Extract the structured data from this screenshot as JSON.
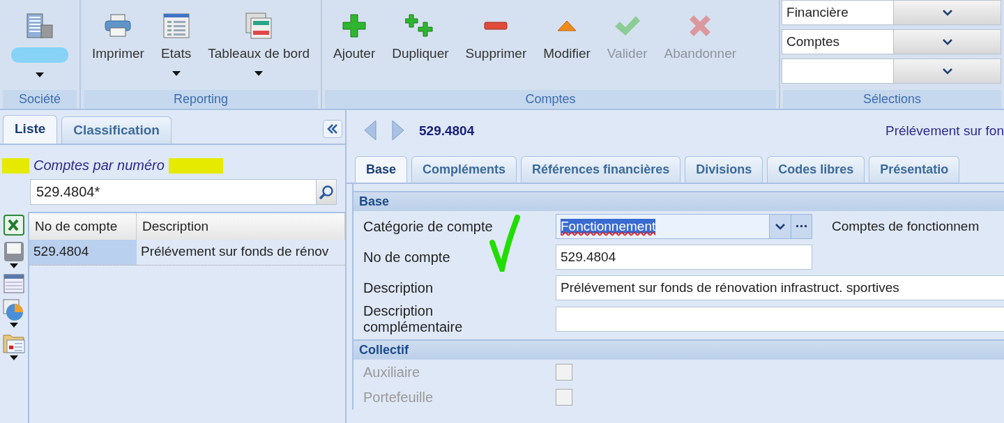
{
  "ribbon": {
    "groups": [
      {
        "label": "Société",
        "buttons": [
          {
            "kind": "company",
            "redacted": true,
            "dropdown": true
          }
        ]
      },
      {
        "label": "Reporting",
        "buttons": [
          {
            "kind": "print",
            "label": "Imprimer",
            "dropdown": false,
            "disabled": false
          },
          {
            "kind": "states",
            "label": "Etats",
            "dropdown": true,
            "disabled": false
          },
          {
            "kind": "dashboard",
            "label": "Tableaux de bord",
            "dropdown": true,
            "disabled": false
          }
        ]
      },
      {
        "label": "Comptes",
        "buttons": [
          {
            "kind": "add",
            "label": "Ajouter",
            "dropdown": false,
            "disabled": false
          },
          {
            "kind": "duplicate",
            "label": "Dupliquer",
            "dropdown": false,
            "disabled": false
          },
          {
            "kind": "remove",
            "label": "Supprimer",
            "dropdown": false,
            "disabled": false
          },
          {
            "kind": "edit",
            "label": "Modifier",
            "dropdown": false,
            "disabled": false
          },
          {
            "kind": "validate",
            "label": "Valider",
            "dropdown": false,
            "disabled": true
          },
          {
            "kind": "cancel",
            "label": "Abandonner",
            "dropdown": false,
            "disabled": true
          }
        ]
      }
    ],
    "selections": {
      "label": "Sélections",
      "dropdowns": [
        {
          "kind": "value",
          "value": "Financière"
        },
        {
          "kind": "value",
          "value": "Comptes"
        },
        {
          "kind": "blank"
        }
      ]
    }
  },
  "left_panel": {
    "tabs": [
      {
        "label": "Liste",
        "selected": true
      },
      {
        "label": "Classification",
        "selected": false
      }
    ],
    "title": "Comptes par numéro",
    "search": {
      "value": "529.4804*"
    },
    "side_tools": [
      {
        "kind": "excel",
        "dropdown": false
      },
      {
        "kind": "save",
        "dropdown": true
      },
      {
        "kind": "layout",
        "dropdown": false
      },
      {
        "kind": "chart",
        "dropdown": true
      },
      {
        "kind": "folder",
        "dropdown": true
      }
    ],
    "table": {
      "columns": [
        "No de compte",
        "Description"
      ],
      "rows": [
        {
          "cells": [
            "529.4804",
            "Prélévement sur fonds de rénov"
          ],
          "selected": true
        }
      ]
    }
  },
  "detail": {
    "number": "529.4804",
    "title": "Prélévement sur fon",
    "tabs": [
      {
        "label": "Base",
        "selected": true
      },
      {
        "label": "Compléments",
        "selected": false
      },
      {
        "label": "Références financières",
        "selected": false
      },
      {
        "label": "Divisions",
        "selected": false
      },
      {
        "label": "Codes libres",
        "selected": false
      },
      {
        "label": "Présentatio",
        "selected": false
      }
    ],
    "sections": [
      {
        "title": "Base",
        "fields": [
          {
            "kind": "combo",
            "label": "Catégorie de compte",
            "value": "Fonctionnement",
            "highlighted": true,
            "note": "Comptes de fonctionnem"
          },
          {
            "kind": "text",
            "label": "No de compte",
            "value": "529.4804",
            "wide": false
          },
          {
            "kind": "text",
            "label": "Description",
            "value": "Prélévement sur fonds de rénovation infrastruct. sportives",
            "wide": true
          },
          {
            "kind": "text",
            "label": "Description complémentaire",
            "wide": true
          }
        ]
      },
      {
        "title": "Collectif",
        "fields": [
          {
            "kind": "checkbox",
            "label": "Auxiliaire",
            "checked": false,
            "disabled": true
          },
          {
            "kind": "checkbox",
            "label": "Portefeuille",
            "checked": false,
            "disabled": true
          }
        ]
      }
    ]
  }
}
